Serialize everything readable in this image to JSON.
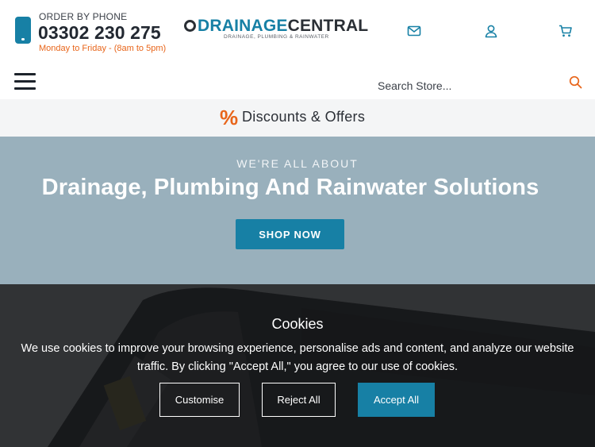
{
  "header": {
    "order_label": "ORDER BY PHONE",
    "phone_number": "03302 230 275",
    "hours": "Monday to Friday - (8am to 5pm)",
    "logo": {
      "drain": "DRAINAGE",
      "central": "CENTRAL",
      "tagline": "DRAINAGE, PLUMBING & RAINWATER"
    },
    "icons": [
      "mail-icon",
      "user-icon",
      "cart-icon",
      "phone-icon"
    ]
  },
  "search": {
    "placeholder": "Search Store..."
  },
  "discount_bar": {
    "label": "Discounts & Offers",
    "icon": "%"
  },
  "hero": {
    "kicker": "WE'RE ALL ABOUT",
    "title": "Drainage, Plumbing And Rainwater Solutions",
    "button": "SHOP NOW"
  },
  "cookies": {
    "title": "Cookies",
    "text": "We use cookies to improve your browsing experience, personalise ads and content, and analyze our website traffic. By clicking \"Accept All,\" you agree to our use of cookies.",
    "customise": "Customise",
    "reject": "Reject All",
    "accept": "Accept All"
  },
  "colors": {
    "brand_blue": "#1780a5",
    "accent_orange": "#e8651a",
    "hero_bg": "#99b0bc"
  }
}
